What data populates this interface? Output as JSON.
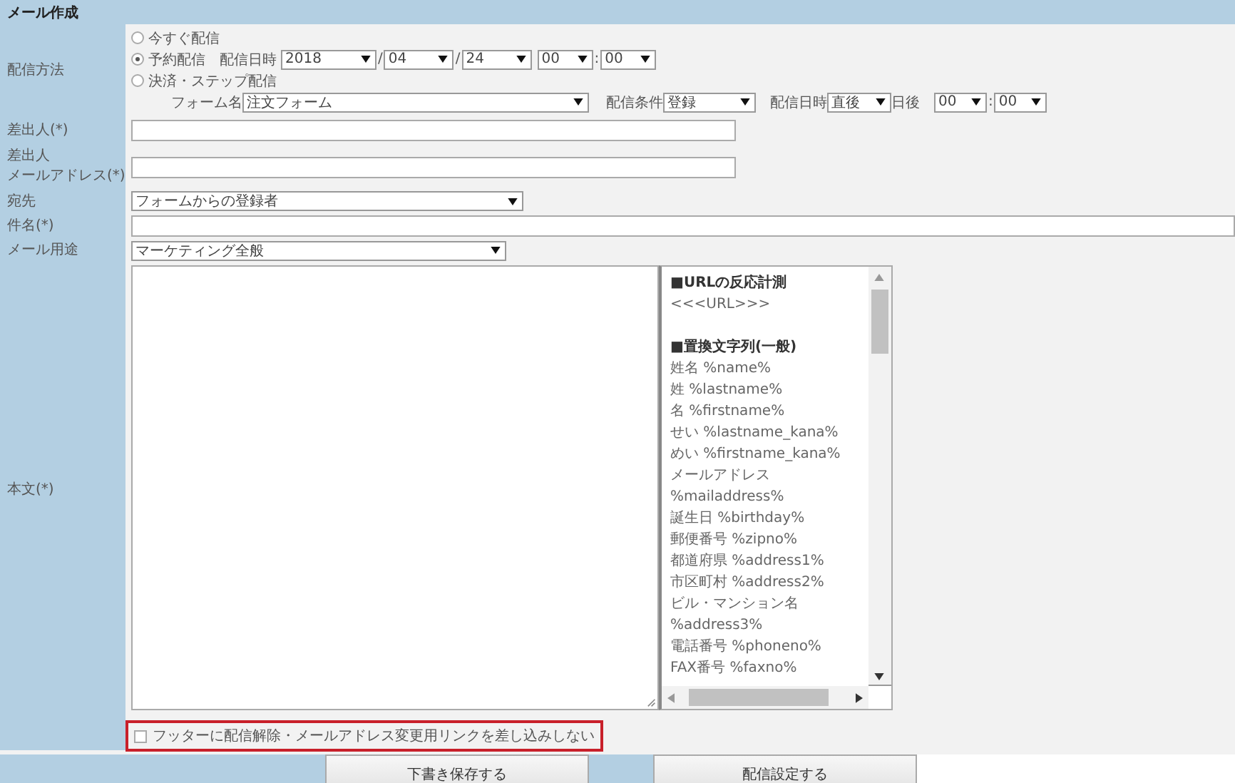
{
  "header": {
    "title": "メール作成"
  },
  "delivery": {
    "label": "配信方法",
    "options": [
      {
        "label": "今すぐ配信",
        "selected": false
      },
      {
        "label": "予約配信",
        "selected": true
      },
      {
        "label": "決済・ステップ配信",
        "selected": false
      }
    ],
    "schedule": {
      "label": "配信日時",
      "year": "2018",
      "month": "04",
      "day": "24",
      "hour": "00",
      "minute": "00",
      "separators": [
        "/",
        "/",
        ":"
      ]
    },
    "step": {
      "form_label": "フォーム名",
      "form": "注文フォーム",
      "condition_label": "配信条件",
      "condition": "登録",
      "timing_label": "配信日時",
      "timing": "直後",
      "days_after": "日後",
      "hour": "00",
      "separator": ":",
      "minute": "00"
    }
  },
  "sender": {
    "label": "差出人(*)"
  },
  "sender_email": {
    "label_lines": [
      "差出人",
      "メールアドレス(*)"
    ]
  },
  "recipient": {
    "label": "宛先",
    "value": "フォームからの登録者"
  },
  "subject": {
    "label": "件名(*)"
  },
  "purpose": {
    "label": "メール用途",
    "value": "マーケティング全般"
  },
  "body": {
    "label": "本文(*)",
    "tags": [
      {
        "kind": "heading",
        "text": "■URLの反応計測"
      },
      {
        "kind": "text",
        "text": "<<<URL>>>"
      },
      {
        "kind": "heading",
        "text": "■置換文字列(一般)"
      },
      {
        "kind": "text",
        "text": "姓名 %name%"
      },
      {
        "kind": "text",
        "text": "姓 %lastname%"
      },
      {
        "kind": "text",
        "text": "名 %firstname%"
      },
      {
        "kind": "text",
        "text": "せい %lastname_kana%"
      },
      {
        "kind": "text",
        "text": "めい %firstname_kana%"
      },
      {
        "kind": "text",
        "text": "メールアドレス"
      },
      {
        "kind": "text",
        "text": "%mailaddress%"
      },
      {
        "kind": "text",
        "text": "誕生日 %birthday%"
      },
      {
        "kind": "text",
        "text": "郵便番号 %zipno%"
      },
      {
        "kind": "text",
        "text": "都道府県 %address1%"
      },
      {
        "kind": "text",
        "text": "市区町村 %address2%"
      },
      {
        "kind": "text",
        "text": "ビル・マンション名"
      },
      {
        "kind": "text",
        "text": "%address3%"
      },
      {
        "kind": "text",
        "text": "電話番号 %phoneno%"
      },
      {
        "kind": "text",
        "text": "FAX番号 %faxno%"
      }
    ]
  },
  "footer_option": {
    "label": "フッターに配信解除・メールアドレス変更用リンクを差し込みしない",
    "checked": false
  },
  "buttons": [
    "下書き保存する",
    "配信設定する"
  ]
}
